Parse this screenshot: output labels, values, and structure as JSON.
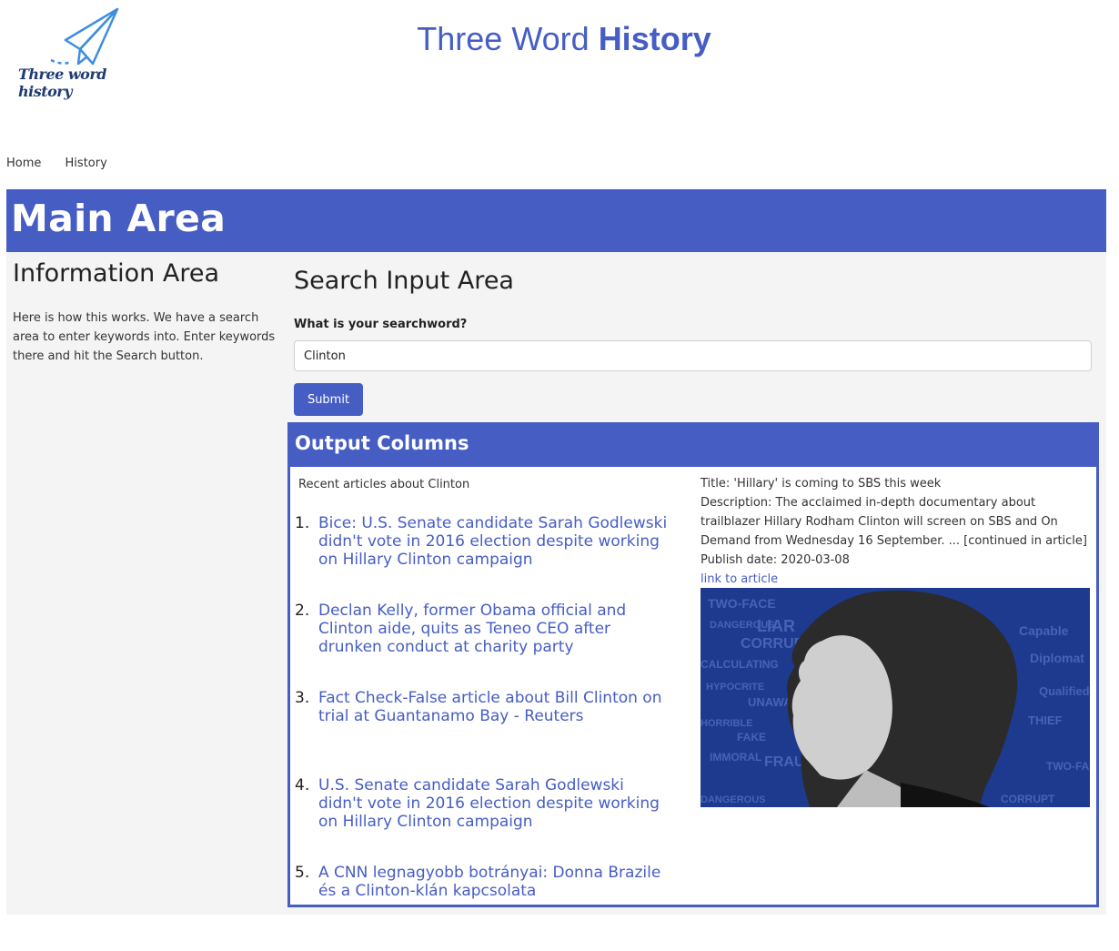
{
  "logo": {
    "text": "Three word history"
  },
  "site_title": {
    "light": "Three Word ",
    "bold": "History"
  },
  "nav": {
    "home": "Home",
    "history": "History"
  },
  "main": {
    "title": "Main Area"
  },
  "info": {
    "title": "Information Area",
    "text": "Here is how this works. We have a search area to enter keywords into. Enter keywords there and hit the Search button."
  },
  "search": {
    "title": "Search Input Area",
    "label": "What is your searchword?",
    "value": "Clinton",
    "submit_label": "Submit"
  },
  "output": {
    "title": "Output Columns",
    "recent_label": "Recent articles about Clinton",
    "articles": [
      {
        "num": "1.",
        "title": "Bice: U.S. Senate candidate Sarah Godlewski didn't vote in 2016 election despite working on Hillary Clinton campaign"
      },
      {
        "num": "2.",
        "title": "Declan Kelly, former Obama official and Clinton aide, quits as Teneo CEO after drunken conduct at charity party"
      },
      {
        "num": "3.",
        "title": "Fact Check-False article about Bill Clinton on trial at Guantanamo Bay - Reuters"
      },
      {
        "num": "4.",
        "title": "U.S. Senate candidate Sarah Godlewski didn't vote in 2016 election despite working on Hillary Clinton campaign"
      },
      {
        "num": "5.",
        "title": "A CNN legnagyobb botrányai: Donna Brazile és a Clinton-klán kapcsolata"
      }
    ],
    "detail": {
      "title": "Title: 'Hillary' is coming to SBS this week",
      "description": "Description: The acclaimed in-depth documentary about trailblazer Hillary Rodham Clinton will screen on SBS and On Demand from Wednesday 16 September. ... [continued in article]",
      "publish_date": "Publish date: 2020-03-08",
      "link_label": "link to article"
    },
    "image_words": [
      "TWO-FACE",
      "DANGEROUS",
      "LIAR",
      "CORRUPT",
      "CALCULATING",
      "HYPOCRITE",
      "UNAWARE",
      "HORRIBLE",
      "FAKE",
      "IMMORAL",
      "FRAUD",
      "Capable",
      "Diplomat",
      "Qualified",
      "THIEF"
    ]
  },
  "colors": {
    "accent": "#465dc4",
    "panel": "#f4f4f4"
  }
}
